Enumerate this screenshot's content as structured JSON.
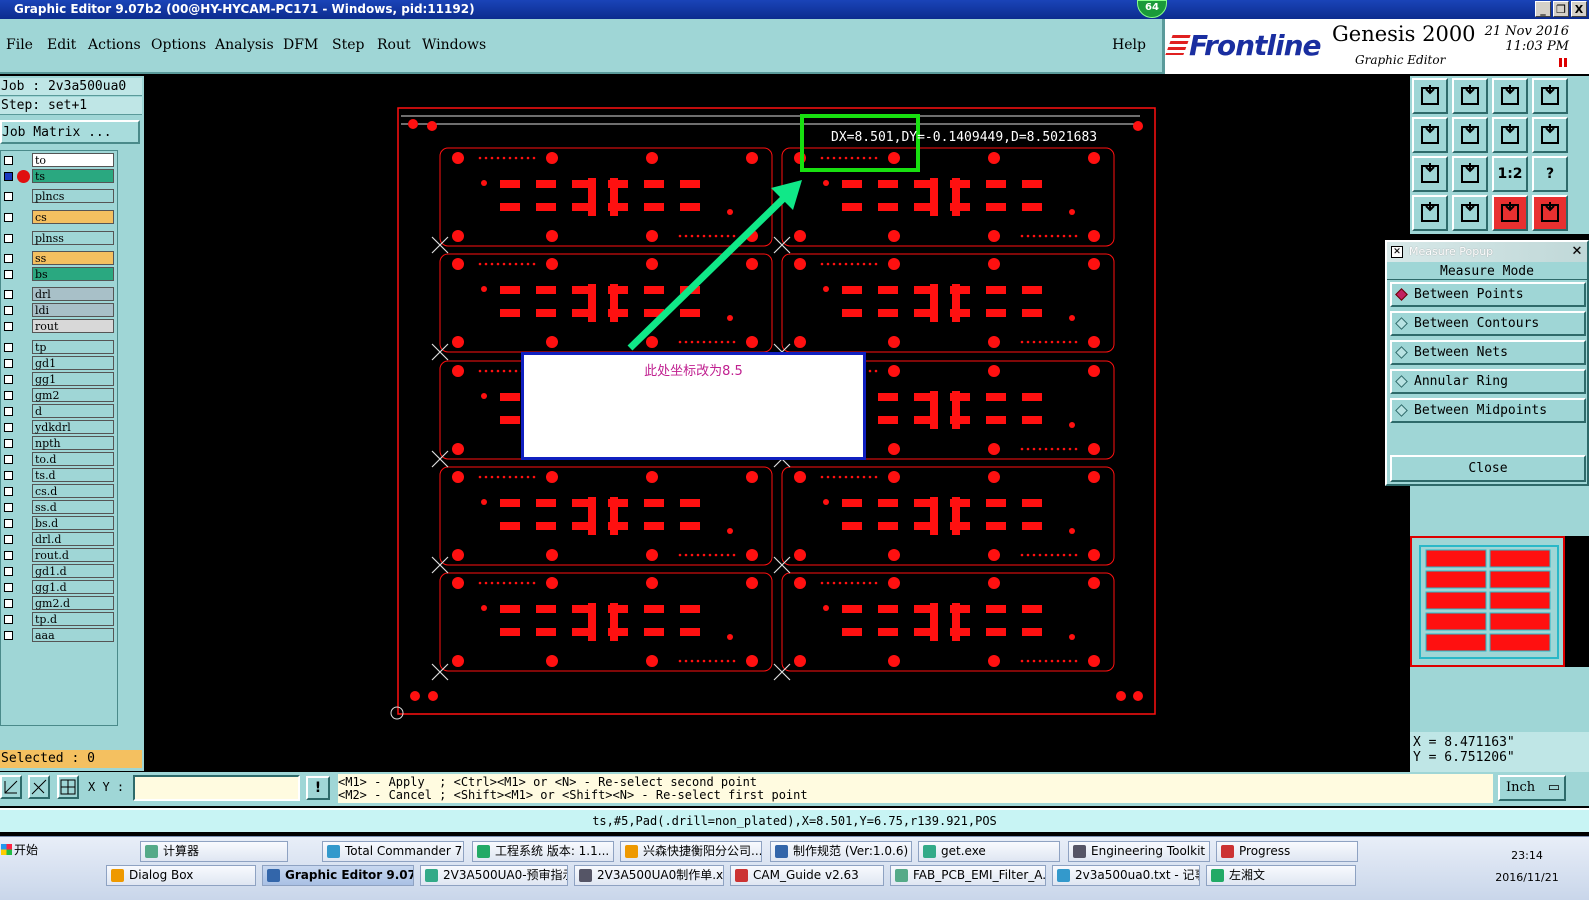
{
  "window": {
    "title": "Graphic Editor 9.07b2 (00@HY-HYCAM-PC171 - Windows, pid:11192)",
    "badge": "64",
    "buttons": [
      "_",
      "❐",
      "X"
    ]
  },
  "menu": {
    "items": [
      "File",
      "Edit",
      "Actions",
      "Options",
      "Analysis",
      "DFM",
      "Step",
      "Rout",
      "Windows"
    ],
    "help": "Help"
  },
  "brand": {
    "logo": "Frontline",
    "product": "Genesis 2000",
    "sub": "Graphic Editor",
    "date": "21 Nov 2016",
    "time": "11:03 PM"
  },
  "job": {
    "job_line": "Job : 2v3a500ua0",
    "step_line": "Step: set+1",
    "matrix_btn": "Job Matrix ..."
  },
  "layers": [
    {
      "name": "to",
      "color": "#ffffff"
    },
    {
      "name": "ts",
      "color": "#2aa880",
      "active": true
    },
    {
      "name": "plncs",
      "color": "#9fd6d6"
    },
    {
      "name": "cs",
      "color": "#f4c060"
    },
    {
      "name": "plnss",
      "color": "#9fd6d6"
    },
    {
      "name": "ss",
      "color": "#f4c060"
    },
    {
      "name": "bs",
      "color": "#2aa880"
    },
    {
      "name": "drl",
      "color": "#a8c0c8"
    },
    {
      "name": "ldi",
      "color": "#a8c0c8"
    },
    {
      "name": "rout",
      "color": "#d8d8d8"
    },
    {
      "name": "tp",
      "color": "#9fd6d6"
    },
    {
      "name": "gd1",
      "color": "#9fd6d6"
    },
    {
      "name": "gg1",
      "color": "#9fd6d6"
    },
    {
      "name": "gm2",
      "color": "#9fd6d6"
    },
    {
      "name": "d",
      "color": "#9fd6d6"
    },
    {
      "name": "ydkdrl",
      "color": "#9fd6d6"
    },
    {
      "name": "npth",
      "color": "#9fd6d6"
    },
    {
      "name": "to.d",
      "color": "#9fd6d6"
    },
    {
      "name": "ts.d",
      "color": "#9fd6d6"
    },
    {
      "name": "cs.d",
      "color": "#9fd6d6"
    },
    {
      "name": "ss.d",
      "color": "#9fd6d6"
    },
    {
      "name": "bs.d",
      "color": "#9fd6d6"
    },
    {
      "name": "drl.d",
      "color": "#9fd6d6"
    },
    {
      "name": "rout.d",
      "color": "#9fd6d6"
    },
    {
      "name": "gd1.d",
      "color": "#9fd6d6"
    },
    {
      "name": "gg1.d",
      "color": "#9fd6d6"
    },
    {
      "name": "gm2.d",
      "color": "#9fd6d6"
    },
    {
      "name": "tp.d",
      "color": "#9fd6d6"
    },
    {
      "name": "aaa",
      "color": "#9fd6d6"
    }
  ],
  "selected": "Selected : 0",
  "canvas": {
    "measure": "DX=8.501,DY=-0.1409449,D=8.5021683",
    "note": "此处坐标改为8.5",
    "pcb_color": "#ff1010",
    "highlight_color": "#18e010",
    "arrow_color": "#10e888"
  },
  "tools": [
    "home-up-icon",
    "home-down-icon",
    "home-icon",
    "window-icon",
    "pan-left-icon",
    "pan-right-icon",
    "fit-icon",
    "zoom-icon",
    "expand-icon",
    "shrink-icon",
    "ratio-icon",
    "help-icon",
    "tool-icon",
    "key-icon",
    "net-icon",
    "net2-icon"
  ],
  "tool_labels": {
    "ratio": "1:2",
    "help": "?"
  },
  "measure_popup": {
    "title": "Measure Popup",
    "header": "Measure Mode",
    "options": [
      {
        "label": "Between Points",
        "selected": true
      },
      {
        "label": "Between Contours",
        "selected": false
      },
      {
        "label": "Between Nets",
        "selected": false
      },
      {
        "label": "Annular Ring",
        "selected": false
      },
      {
        "label": "Between Midpoints",
        "selected": false
      }
    ],
    "close": "Close"
  },
  "coords": {
    "x": "X = 8.471163\"",
    "y": "Y = 6.751206\""
  },
  "bottom": {
    "xy_label": "X Y :",
    "xy_value": "",
    "hint1": "<M1> - Apply  ; <Ctrl><M1> or <N> - Re-select second point",
    "hint2": "<M2> - Cancel ; <Shift><M1> or <Shift><N> - Re-select first point",
    "units": "Inch",
    "status": "ts,#5,Pad(.drill=non_plated),X=8.501,Y=6.75,r139.921,POS"
  },
  "taskbar": {
    "start": "开始",
    "row1": [
      "计算器",
      "Total Commander 7.0 ...",
      "工程系统  版本: 1.1...",
      "兴森快捷衡阳分公司...",
      "制作规范 (Ver:1.0.6)",
      "get.exe",
      "Engineering Toolkit 9.0...",
      "Progress"
    ],
    "row2": [
      "Dialog Box",
      "Graphic Editor 9.07b2...",
      "2V3A500UA0-预审指示...",
      "2V3A500UA0制作单.xls...",
      "CAM_Guide v2.63",
      "FAB_PCB_EMI_Filter_A....",
      "2v3a500ua0.txt - 记事本",
      "左湘文"
    ],
    "time": "23:14",
    "date": "2016/11/21"
  }
}
